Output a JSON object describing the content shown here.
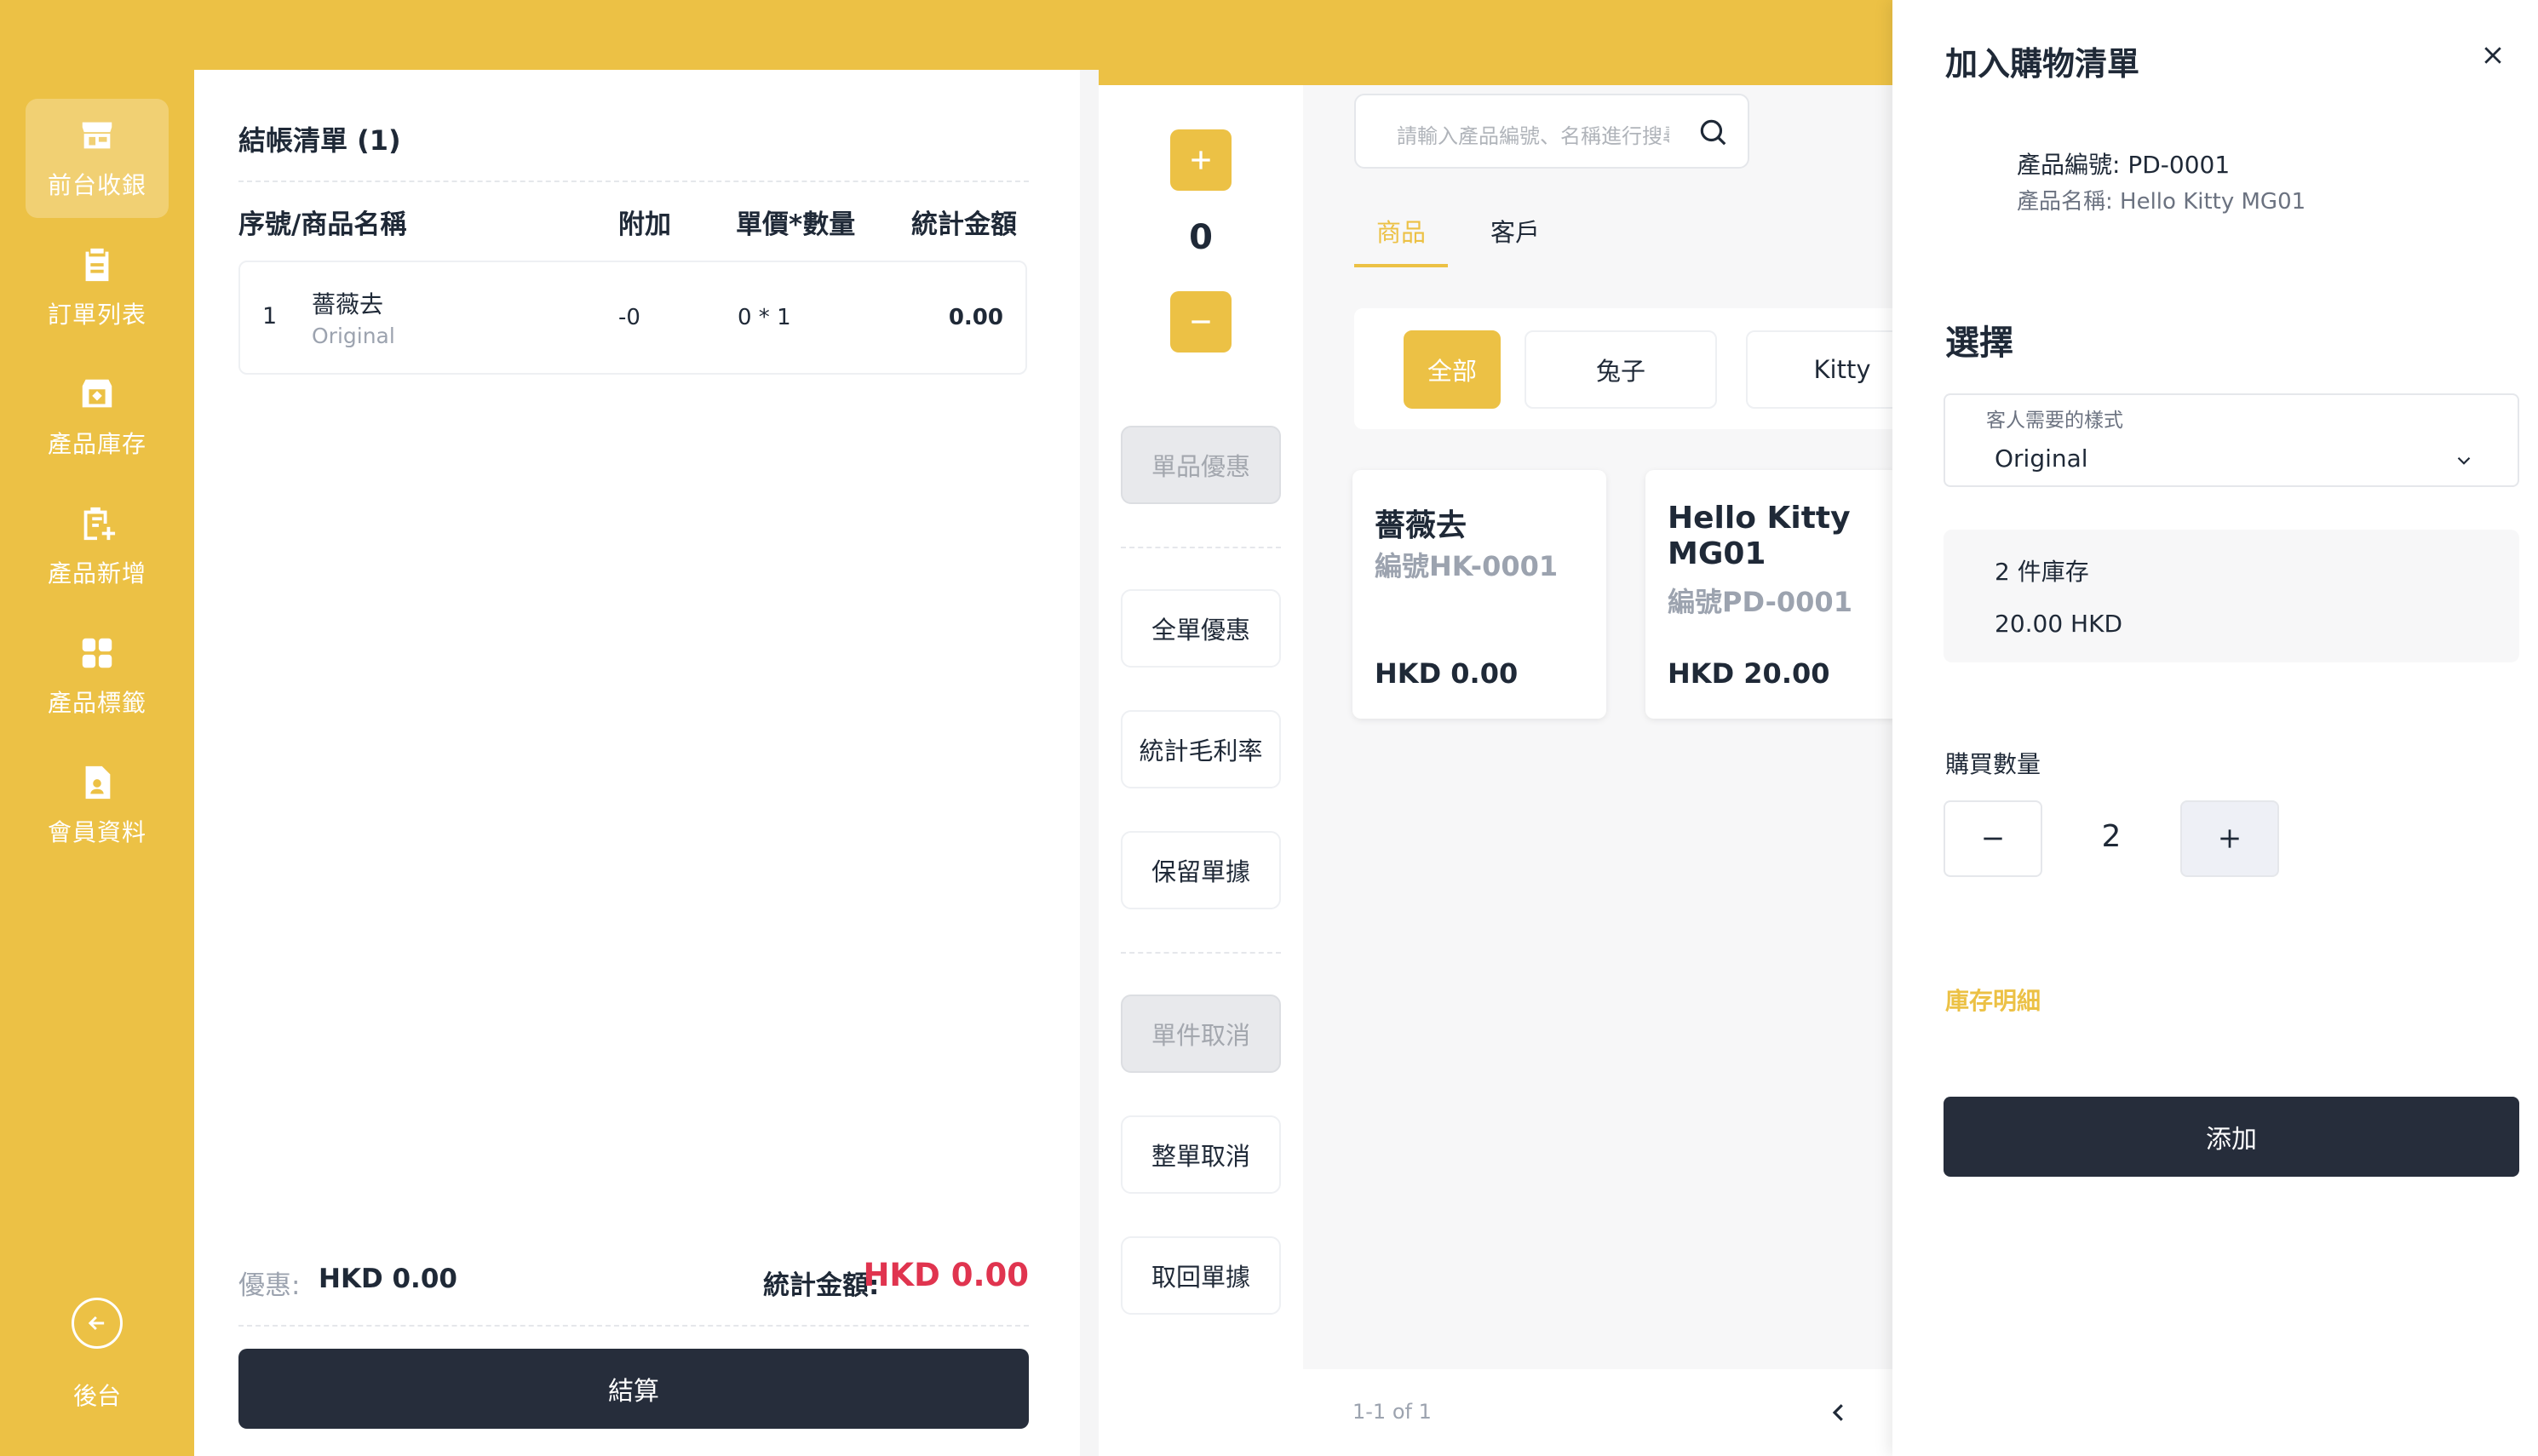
{
  "sidebar": {
    "items": [
      {
        "label": "前台收銀",
        "icon": "store-icon"
      },
      {
        "label": "訂單列表",
        "icon": "clipboard-icon"
      },
      {
        "label": "產品庫存",
        "icon": "inventory-box-icon"
      },
      {
        "label": "產品新增",
        "icon": "add-product-icon"
      },
      {
        "label": "產品標籤",
        "icon": "tags-grid-icon"
      },
      {
        "label": "會員資料",
        "icon": "member-file-icon"
      }
    ],
    "back_label": "後台"
  },
  "checkout": {
    "title": "結帳清單 (1)",
    "columns": [
      "序號/商品名稱",
      "附加",
      "單價*數量",
      "統計金額"
    ],
    "rows": [
      {
        "index": "1",
        "name": "薔薇去",
        "variant": "Original",
        "addon": "-0",
        "price_qty": "0 * 1",
        "total": "0.00"
      }
    ],
    "discount_label": "優惠:",
    "discount_value": "HKD 0.00",
    "sum_label": "統計金額:",
    "sum_value": "HKD 0.00",
    "checkout_button": "結算"
  },
  "actions": {
    "counter": "0",
    "single_discount": "單品優惠",
    "order_discount": "全單優惠",
    "gross_margin": "統計毛利率",
    "hold_order": "保留單據",
    "cancel_item": "單件取消",
    "cancel_order": "整單取消",
    "retrieve_order": "取回單據"
  },
  "products": {
    "search_placeholder": "請輸入產品編號、名稱進行搜尋",
    "tabs": [
      "商品",
      "客戶"
    ],
    "categories": [
      "全部",
      "兔子",
      "Kitty"
    ],
    "cards": [
      {
        "name": "薔薇去",
        "code": "編號HK-0001",
        "price": "HKD  0.00"
      },
      {
        "name": "Hello Kitty MG01",
        "code": "編號PD-0001",
        "price": "HKD  20.00"
      }
    ],
    "pagination": "1-1  of   1"
  },
  "drawer": {
    "title": "加入購物清單",
    "product_code": "產品編號:  PD-0001",
    "product_name": "產品名稱:  Hello Kitty MG01",
    "select_heading": "選擇",
    "style_label": "客人需要的樣式",
    "style_value": "Original",
    "stock_text": "2  件庫存",
    "price_text": "20.00 HKD",
    "qty_label": "購買數量",
    "qty_value": "2",
    "stock_detail_link": "庫存明細",
    "add_button": "添加"
  },
  "colors": {
    "brand_yellow": "#ECC145",
    "dark_button": "#262D3B",
    "accent_red": "#E0344F"
  }
}
